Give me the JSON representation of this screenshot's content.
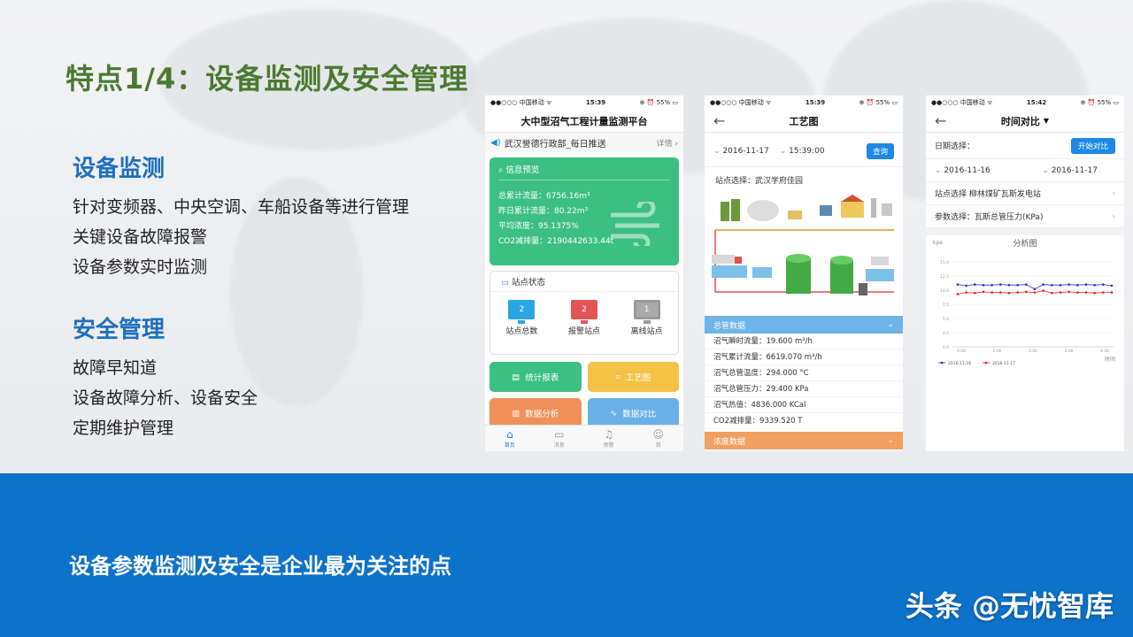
{
  "slide": {
    "title": "特点1/4：设备监测及安全管理",
    "sections": [
      {
        "heading": "设备监测",
        "lines": [
          "针对变频器、中央空调、车船设备等进行管理",
          "关键设备故障报警",
          "设备参数实时监测"
        ]
      },
      {
        "heading": "安全管理",
        "lines": [
          "故障早知道",
          "设备故障分析、设备安全",
          "定期维护管理"
        ]
      }
    ],
    "bottom_text": "设备参数监测及安全是企业最为关注的点",
    "watermark": "头条 @无忧智库"
  },
  "phone1": {
    "status_carrier": "●●○○○ 中国移动 ᯤ",
    "status_time": "15:39",
    "status_battery": "⊕ ⏰ 55% ▭",
    "title": "大中型沼气工程计量监测平台",
    "notice": "武汉誉德行政部_每日推送",
    "notice_more": "详情 ›",
    "info_title": "信息预览",
    "info_rows": [
      "总累计流量：6756.16m³",
      "昨日累计流量：80.22m³",
      "平均浓度：95.1375%",
      "CO2减排量：2190442633.44t"
    ],
    "status_title": "站点状态",
    "status_items": [
      {
        "count": "2",
        "label": "站点总数",
        "color": "#2aa6e0"
      },
      {
        "count": "2",
        "label": "报警站点",
        "color": "#e05555"
      },
      {
        "count": "1",
        "label": "离线站点",
        "color": "#999999"
      }
    ],
    "tiles": [
      {
        "label": "统计报表",
        "color": "#3cbf83",
        "icon": "report-icon"
      },
      {
        "label": "工艺图",
        "color": "#f4c245",
        "icon": "process-icon"
      },
      {
        "label": "数据分析",
        "color": "#f0905a",
        "icon": "bar-chart-icon"
      },
      {
        "label": "数据对比",
        "color": "#6ab0e8",
        "icon": "line-chart-icon"
      }
    ],
    "tabs": [
      {
        "label": "首页",
        "icon": "home-icon"
      },
      {
        "label": "消息",
        "icon": "message-icon"
      },
      {
        "label": "预警",
        "icon": "bell-icon"
      },
      {
        "label": "我",
        "icon": "user-icon"
      }
    ]
  },
  "phone2": {
    "status_carrier": "●●○○○ 中国移动 ᯤ",
    "status_time": "15:39",
    "status_battery": "⊕ ⏰ 55% ▭",
    "title": "工艺图",
    "date": "2016-11-17",
    "time": "15:39:00",
    "query_label": "查询",
    "station": "站点选择：武汉学府佳园",
    "section1": "总管数据",
    "section1_color": "#6fb4e8",
    "data_rows": [
      "沼气瞬时流量：19.600 m³/h",
      "沼气累计流量：6619.070 m³/h",
      "沼气总管温度：294.000 °C",
      "沼气总管压力：29.400 KPa",
      "沼气热值：4836.000 KCal",
      "CO2减排量：9339.520 T"
    ],
    "section2": "浓度数据",
    "section2_color": "#f0a060"
  },
  "phone3": {
    "status_carrier": "●●○○○ 中国移动 ᯤ",
    "status_time": "15:42",
    "status_battery": "⊕ ⏰ 55% ▭",
    "title": "时间对比",
    "date_label": "日期选择：",
    "start_label": "开始对比",
    "date1": "2016-11-16",
    "date2": "2016-11-17",
    "station": "站点选择  柳林煤矿瓦斯发电站",
    "param": "参数选择：瓦斯总管压力(KPa)",
    "chart_title": "分析图"
  },
  "chart_data": {
    "type": "line",
    "title": "分析图",
    "ylabel": "kpa",
    "xlabel": "时间",
    "ylim": [
      0,
      15
    ],
    "yticks": [
      "15.0",
      "12.5",
      "10.0",
      "7.5",
      "5.0",
      "2.5",
      "0.0"
    ],
    "xticks": [
      "0:00",
      "1:00",
      "2:00",
      "3:00",
      "4:00"
    ],
    "series": [
      {
        "name": "2016-11-16",
        "color": "#2230d0",
        "values": [
          11.0,
          10.8,
          11.0,
          10.9,
          10.9,
          11.0,
          10.9,
          10.9,
          11.0,
          10.2,
          11.0,
          10.9,
          10.9,
          11.0,
          10.9,
          11.0,
          10.9,
          11.0,
          10.8
        ]
      },
      {
        "name": "2016-11-17",
        "color": "#e02020",
        "values": [
          9.3,
          9.6,
          9.5,
          9.7,
          9.6,
          9.6,
          9.5,
          9.6,
          9.7,
          9.6,
          9.9,
          9.5,
          9.6,
          9.7,
          9.6,
          9.6,
          9.5,
          9.6,
          9.6
        ]
      }
    ]
  }
}
